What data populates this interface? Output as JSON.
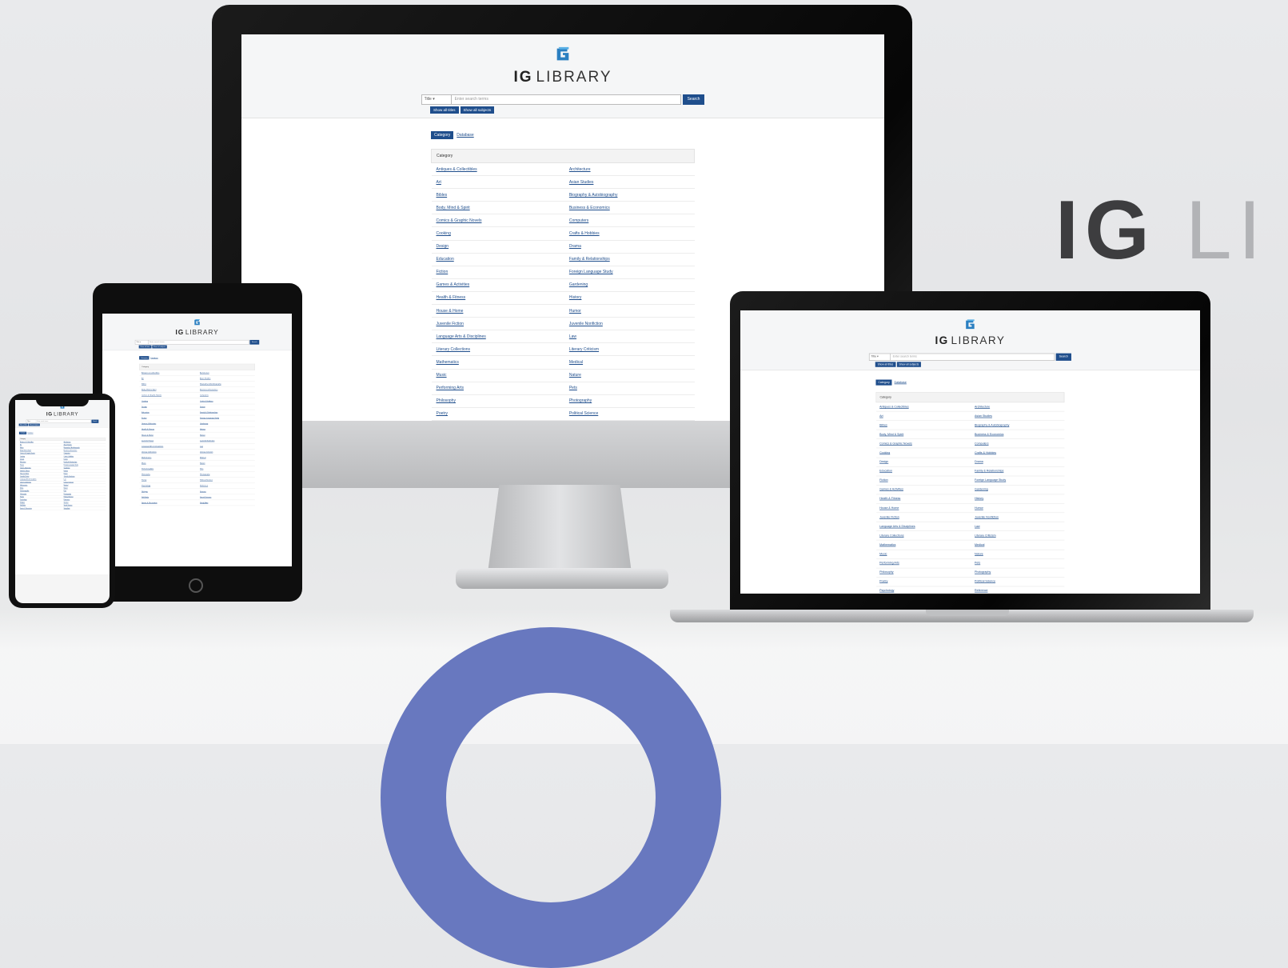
{
  "brand": {
    "wordmark_ig": "IG",
    "wordmark_rest": "LI",
    "logo_primary": "IG",
    "logo_secondary": "LIBRARY",
    "accent_color": "#1f4e8c",
    "ring_color": "#6878bf"
  },
  "search": {
    "field_select": "Title",
    "placeholder": "Enter search terms",
    "button_label": "Search",
    "pill_all_titles": "Show all titles",
    "pill_all_subjects": "Show all subjects"
  },
  "tabs": {
    "active": "Category",
    "inactive": "Database"
  },
  "table": {
    "header": "Category",
    "rows": [
      [
        "Antiques & Collectibles",
        "Architecture"
      ],
      [
        "Art",
        "Asian Studies"
      ],
      [
        "Bibles",
        "Biography & Autobiography"
      ],
      [
        "Body, Mind & Spirit",
        "Business & Economics"
      ],
      [
        "Comics & Graphic Novels",
        "Computers"
      ],
      [
        "Cooking",
        "Crafts & Hobbies"
      ],
      [
        "Design",
        "Drama"
      ],
      [
        "Education",
        "Family & Relationships"
      ],
      [
        "Fiction",
        "Foreign Language Study"
      ],
      [
        "Games & Activities",
        "Gardening"
      ],
      [
        "Health & Fitness",
        "History"
      ],
      [
        "House & Home",
        "Humor"
      ],
      [
        "Juvenile Fiction",
        "Juvenile Nonfiction"
      ],
      [
        "Language Arts & Disciplines",
        "Law"
      ],
      [
        "Literary Collections",
        "Literary Criticism"
      ],
      [
        "Mathematics",
        "Medical"
      ],
      [
        "Music",
        "Nature"
      ],
      [
        "Performing Arts",
        "Pets"
      ],
      [
        "Philosophy",
        "Photography"
      ],
      [
        "Poetry",
        "Political Science"
      ],
      [
        "Psychology",
        "Reference"
      ],
      [
        "Religion",
        "Science"
      ],
      [
        "Self-Help",
        "Social Science"
      ],
      [
        "Sports & Recreation",
        "Study Aids"
      ]
    ]
  }
}
